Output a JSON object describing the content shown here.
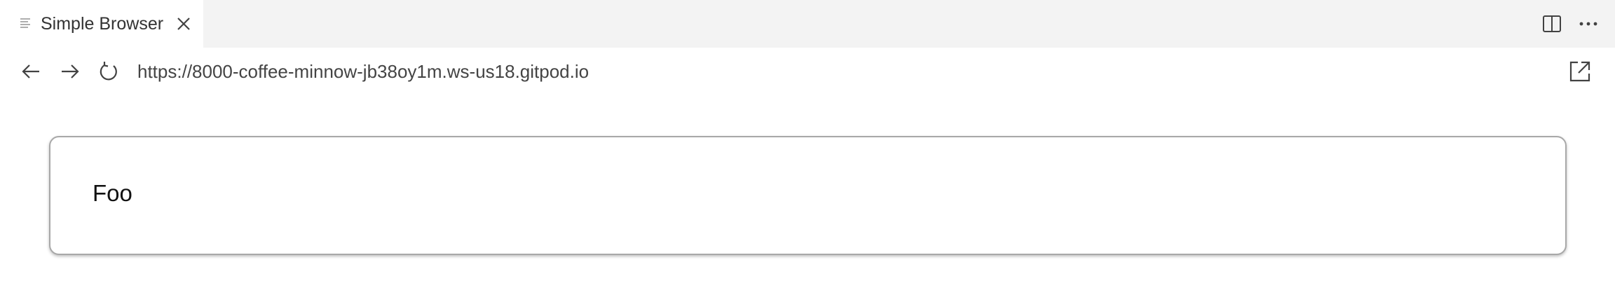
{
  "tab": {
    "title": "Simple Browser",
    "icon": "lines-icon",
    "close_icon": "close-icon"
  },
  "tabbar_actions": [
    {
      "icon": "split-editor-icon"
    },
    {
      "icon": "more-actions-icon"
    }
  ],
  "navbar": {
    "back_icon": "arrow-left-icon",
    "forward_icon": "arrow-right-icon",
    "reload_icon": "reload-icon",
    "url": "https://8000-coffee-minnow-jb38oy1m.ws-us18.gitpod.io",
    "open_external_icon": "open-external-icon"
  },
  "page": {
    "card_text": "Foo"
  },
  "colors": {
    "tabbar_bg": "#f3f3f3",
    "active_tab_bg": "#ffffff",
    "card_border": "#a8a8a8",
    "icon_color": "#424242"
  }
}
